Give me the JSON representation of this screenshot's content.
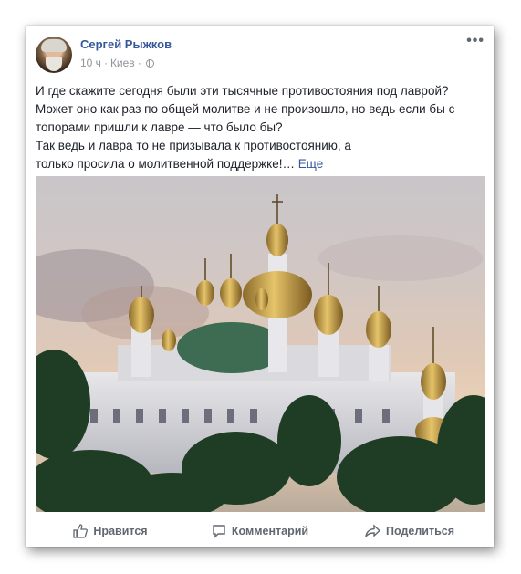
{
  "post": {
    "author": "Сергей Рыжков",
    "time": "10 ч",
    "location": "Киев",
    "separator": "·",
    "privacy_icon": "globe-icon",
    "menu_icon": "more-options-icon",
    "text_lines": [
      "И где скажите сегодня были эти тысячные противостояния под лаврой?",
      "Может оно как раз по общей молитве и не произошло, но ведь если бы с",
      "топорами пришли к лавре — что было бы?",
      "Так ведь и лавра то не призывала к противостоянию, а",
      "только просила о молитвенной поддержке!"
    ],
    "ellipsis": "…",
    "see_more": "Еще"
  },
  "actions": {
    "like": "Нравится",
    "comment": "Комментарий",
    "share": "Поделиться"
  },
  "colors": {
    "link": "#365899",
    "text": "#1d2129",
    "meta": "#90949c"
  }
}
